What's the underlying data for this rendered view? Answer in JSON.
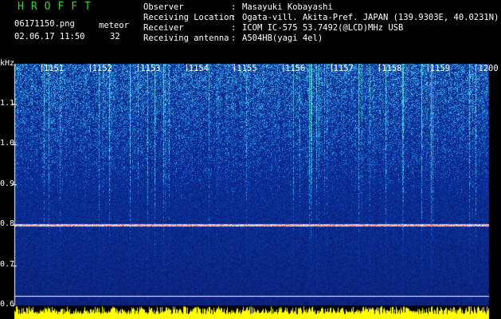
{
  "app": {
    "title": "HROFFT"
  },
  "file": {
    "name": "06171150.png",
    "datetime": "02.06.17 11:50"
  },
  "counter": {
    "label": "meteor",
    "value": "32"
  },
  "station": [
    {
      "label": "Observer",
      "value": "Masayuki Kobayashi"
    },
    {
      "label": "Receiving Location",
      "value": "Ogata-vill. Akita-Pref. JAPAN (139.9303E, 40.0231N)"
    },
    {
      "label": "Receiver",
      "value": "ICOM IC-575 53.7492(@LCD)MHz USB"
    },
    {
      "label": "Receiving antenna",
      "value": "A504HB(yagi 4el)"
    }
  ],
  "chart_data": {
    "type": "heatmap",
    "ylabel": "kHz",
    "ylim": [
      0.6,
      1.2
    ],
    "y_ticks": [
      "1.1",
      "1.0",
      "0.9",
      "0.8",
      "0.7",
      "0.6"
    ],
    "x_ticks": [
      "1151",
      "1152",
      "1153",
      "1154",
      "1155",
      "1156",
      "1157",
      "1158",
      "1159",
      "1200"
    ],
    "carrier_khz": 0.8,
    "colors": {
      "background": "#0a1c6e",
      "noise_high": "#28c8ff",
      "carrier": "#ff3030",
      "level": "#ffff00"
    }
  }
}
